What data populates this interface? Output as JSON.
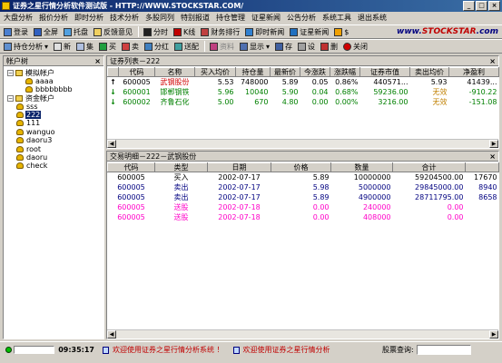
{
  "window": {
    "title": "证券之星行情分析软件测试版 - HTTP://WWW.STOCKSTAR.COM/",
    "min": "_",
    "max": "□",
    "close": "×"
  },
  "menu": [
    "大盘分析",
    "报价分析",
    "即时分析",
    "技术分析",
    "多股同列",
    "特别报道",
    "持仓管理",
    "证星新闻",
    "公告分析",
    "系统工具",
    "退出系统"
  ],
  "toolbar1": {
    "buttons": [
      "登录",
      "全屏",
      "托盘",
      "反馈意见",
      "分时",
      "K线",
      "财务排行",
      "即时新闻",
      "证星新闻",
      "$"
    ],
    "brand_prefix": "www.",
    "brand_main": "STOCKSTAR",
    "brand_suffix": ".com"
  },
  "toolbar2": {
    "buttons": [
      "持仓分析",
      "新",
      "集",
      "买",
      "卖",
      "分红",
      "送配",
      "资料",
      "显示",
      "存",
      "设",
      "删",
      "关闭"
    ]
  },
  "account_tree": {
    "title": "帐户树",
    "close": "×",
    "nodes": [
      {
        "label": "模拟帐户",
        "level": 0,
        "box": "−"
      },
      {
        "label": "aaaa",
        "level": 2
      },
      {
        "label": "bbbbbbbb",
        "level": 2
      },
      {
        "label": "资金帐户",
        "level": 0,
        "box": "−"
      },
      {
        "label": "sss",
        "level": 1
      },
      {
        "label": "222",
        "level": 1,
        "selected": true
      },
      {
        "label": "111",
        "level": 1
      },
      {
        "label": "wanguo",
        "level": 1
      },
      {
        "label": "daoru3",
        "level": 1
      },
      {
        "label": "root",
        "level": 1
      },
      {
        "label": "daoru",
        "level": 1
      },
      {
        "label": "check",
        "level": 1
      }
    ]
  },
  "securities": {
    "title": "证券列表－222",
    "close": "×",
    "columns": [
      "",
      "代码",
      "名称",
      "买入均价",
      "持仓量",
      "最新价",
      "今涨跌",
      "涨跌幅",
      "证券市值",
      "卖出均价",
      "净盈利"
    ],
    "rows": [
      {
        "arrow": "↑",
        "dir": "up",
        "style": "black",
        "cells": [
          "600005",
          "武钢股份",
          "5.53",
          "748000",
          "5.89",
          "0.05",
          "0.86%",
          "440571...",
          "5.93",
          "41439..."
        ]
      },
      {
        "arrow": "↓",
        "dir": "dn",
        "style": "green",
        "cells": [
          "600001",
          "邯郸钢铁",
          "5.96",
          "10040",
          "5.90",
          "0.04",
          "0.68%",
          "59236.00",
          "无效",
          "-910.22"
        ]
      },
      {
        "arrow": "↓",
        "dir": "dn",
        "style": "green",
        "cells": [
          "600002",
          "齐鲁石化",
          "5.00",
          "670",
          "4.80",
          "0.00",
          "0.00%",
          "3216.00",
          "无效",
          "-151.08"
        ]
      }
    ]
  },
  "trades": {
    "title": "交易明细－222－武钢股份",
    "close": "×",
    "columns": [
      "代码",
      "类型",
      "日期",
      "价格",
      "数量",
      "合计",
      ""
    ],
    "rows": [
      {
        "style": "black",
        "cells": [
          "600005",
          "买入",
          "2002-07-17",
          "5.89",
          "10000000",
          "59204500.00",
          "17670"
        ]
      },
      {
        "style": "blue",
        "cells": [
          "600005",
          "卖出",
          "2002-07-17",
          "5.98",
          "5000000",
          "29845000.00",
          "8940"
        ]
      },
      {
        "style": "blue",
        "cells": [
          "600005",
          "卖出",
          "2002-07-17",
          "5.89",
          "4900000",
          "28711795.00",
          "8658"
        ]
      },
      {
        "style": "pink",
        "cells": [
          "600005",
          "送股",
          "2002-07-18",
          "0.00",
          "240000",
          "0.00",
          ""
        ]
      },
      {
        "style": "pink",
        "cells": [
          "600005",
          "送股",
          "2002-07-18",
          "0.00",
          "408000",
          "0.00",
          ""
        ]
      }
    ]
  },
  "status": {
    "time": "09:35:17",
    "ticker1": "欢迎使用证券之星行情分析系统 ！",
    "ticker2": "欢迎使用证券之星行情分析",
    "quote_label": "股票查询:"
  }
}
